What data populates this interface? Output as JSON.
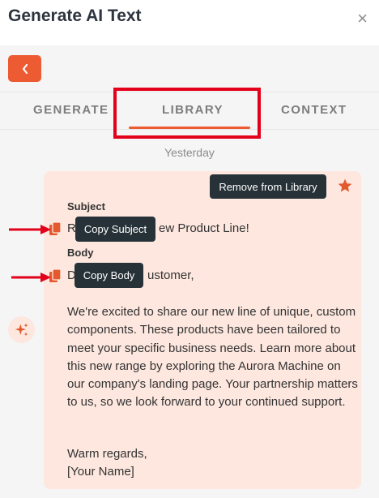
{
  "header": {
    "title": "Generate AI Text",
    "close_symbol": "×"
  },
  "tabs": [
    {
      "label": "GENERATE",
      "active": false
    },
    {
      "label": "LIBRARY",
      "active": true
    },
    {
      "label": "CONTEXT",
      "active": false
    }
  ],
  "library": {
    "group_label": "Yesterday",
    "item": {
      "remove_label": "Remove from Library",
      "subject_label": "Subject",
      "subject_visible_start": "R",
      "subject_visible_end": "ew Product Line!",
      "body_label": "Body",
      "greeting_visible_start": "D",
      "greeting_visible_end": "ustomer,",
      "paragraph": "We're excited to share our new line of unique, custom components. These products have been tailored to meet your specific business needs. Learn more about this new range by exploring the Aurora Machine on our company's landing page. Your partnership matters to us, so we look forward to your continued support.",
      "signoff": "Warm regards,",
      "signature": "[Your Name]"
    }
  },
  "tooltips": {
    "copy_subject": "Copy Subject",
    "copy_body": "Copy Body"
  },
  "colors": {
    "accent": "#ec5b32",
    "card_bg": "#fde7df",
    "tooltip_bg": "#263238",
    "annotation_red": "#e3001b"
  },
  "icons": {
    "back": "chevron-left-icon",
    "close": "close-icon",
    "star": "star-icon",
    "copy": "copy-icon",
    "sparkle": "sparkle-icon"
  }
}
